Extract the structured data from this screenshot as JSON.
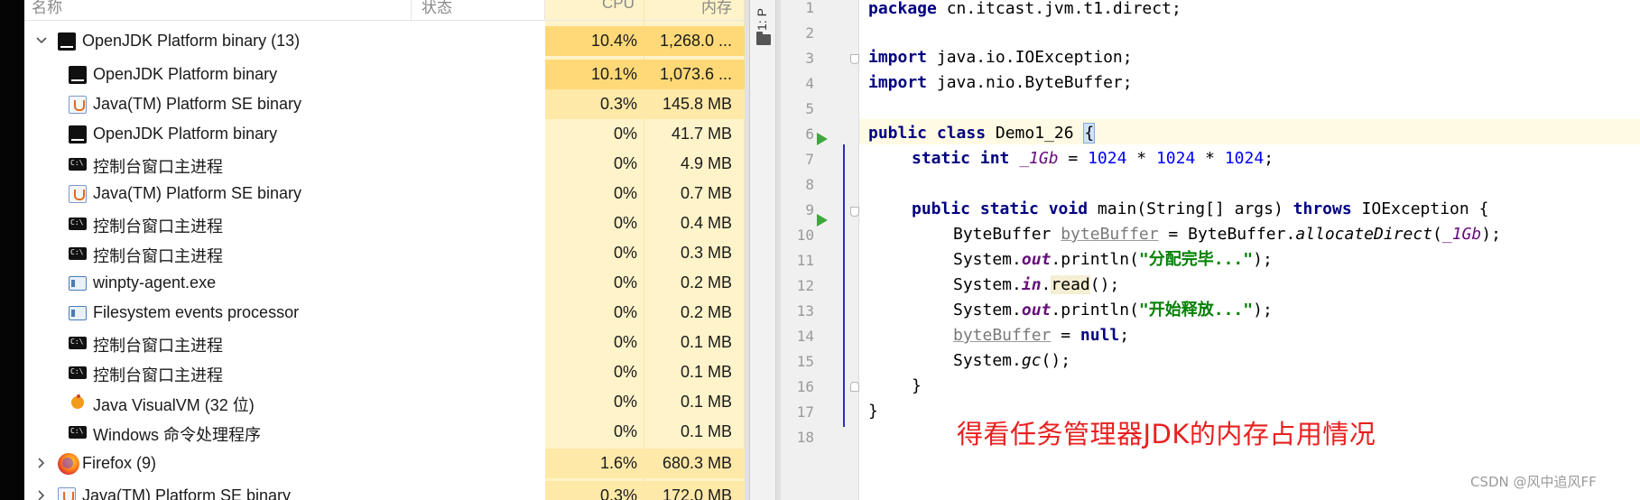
{
  "task_manager": {
    "columns": {
      "name": "名称",
      "status": "状态",
      "cpu": "CPU",
      "memory": "内存"
    },
    "rows": [
      {
        "name": "OpenJDK Platform binary (13)",
        "cpu": "10.4%",
        "mem": "1,268.0 ...",
        "icon": "jetbrains-icon",
        "group": true,
        "expanded": true
      },
      {
        "name": "OpenJDK Platform binary",
        "cpu": "10.1%",
        "mem": "1,073.6 ...",
        "icon": "jetbrains-icon"
      },
      {
        "name": "Java(TM) Platform SE binary",
        "cpu": "0.3%",
        "mem": "145.8 MB",
        "icon": "java-icon"
      },
      {
        "name": "OpenJDK Platform binary",
        "cpu": "0%",
        "mem": "41.7 MB",
        "icon": "jetbrains-icon"
      },
      {
        "name": "控制台窗口主进程",
        "cpu": "0%",
        "mem": "4.9 MB",
        "icon": "console-icon"
      },
      {
        "name": "Java(TM) Platform SE binary",
        "cpu": "0%",
        "mem": "0.7 MB",
        "icon": "java-icon"
      },
      {
        "name": "控制台窗口主进程",
        "cpu": "0%",
        "mem": "0.4 MB",
        "icon": "console-icon"
      },
      {
        "name": "控制台窗口主进程",
        "cpu": "0%",
        "mem": "0.3 MB",
        "icon": "console-icon"
      },
      {
        "name": "winpty-agent.exe",
        "cpu": "0%",
        "mem": "0.2 MB",
        "icon": "window-icon"
      },
      {
        "name": "Filesystem events processor",
        "cpu": "0%",
        "mem": "0.2 MB",
        "icon": "window-icon"
      },
      {
        "name": "控制台窗口主进程",
        "cpu": "0%",
        "mem": "0.1 MB",
        "icon": "console-icon"
      },
      {
        "name": "控制台窗口主进程",
        "cpu": "0%",
        "mem": "0.1 MB",
        "icon": "console-icon"
      },
      {
        "name": "Java VisualVM (32 位)",
        "cpu": "0%",
        "mem": "0.1 MB",
        "icon": "visualvm-icon"
      },
      {
        "name": "Windows 命令处理程序",
        "cpu": "0%",
        "mem": "0.1 MB",
        "icon": "console-icon"
      },
      {
        "name": "Firefox (9)",
        "cpu": "1.6%",
        "mem": "680.3 MB",
        "icon": "firefox-icon",
        "group": true,
        "expanded": false
      },
      {
        "name": "Java(TM) Platform SE binary",
        "cpu": "0.3%",
        "mem": "172.0 MB",
        "icon": "java-icon",
        "group": true,
        "expanded": false
      }
    ],
    "highlight_colors": {
      "light": "#fff3c9",
      "medium": "#ffe9a8",
      "strong": "#ffd978"
    }
  },
  "ide": {
    "project_tab": "1: P",
    "lines": [
      {
        "n": "1"
      },
      {
        "n": "2"
      },
      {
        "n": "3"
      },
      {
        "n": "4"
      },
      {
        "n": "5"
      },
      {
        "n": "6"
      },
      {
        "n": "7"
      },
      {
        "n": "8"
      },
      {
        "n": "9"
      },
      {
        "n": "10"
      },
      {
        "n": "11"
      },
      {
        "n": "12"
      },
      {
        "n": "13"
      },
      {
        "n": "14"
      },
      {
        "n": "15"
      },
      {
        "n": "16"
      },
      {
        "n": "17"
      },
      {
        "n": "18"
      }
    ],
    "code": {
      "l1_kw": "package",
      "l1_rest": " cn.itcast.jvm.t1.direct;",
      "l3_kw": "import",
      "l3_rest": " java.io.IOException;",
      "l4_kw": "import",
      "l4_rest": " java.nio.ByteBuffer;",
      "l6_kw": "public class",
      "l6_rest": " Demo1_26 ",
      "l6_brace": "{",
      "l7_kw": "static int",
      "l7_sp": " ",
      "l7_field": "_1Gb",
      "l7_eq": " = ",
      "l7_n1": "1024",
      "l7_op1": " * ",
      "l7_n2": "1024",
      "l7_op2": " * ",
      "l7_n3": "1024",
      "l7_end": ";",
      "l9_kw": "public static void",
      "l9_mid": " main(String[] args) ",
      "l9_kw2": "throws",
      "l9_rest": " IOException {",
      "l10_a": "ByteBuffer ",
      "l10_var": "byteBuffer",
      "l10_b": " = ByteBuffer.",
      "l10_m": "allocateDirect",
      "l10_c": "(",
      "l10_field": "_1Gb",
      "l10_d": ");",
      "l11_a": "System.",
      "l11_f": "out",
      "l11_b": ".println(",
      "l11_s": "\"分配完毕...\"",
      "l11_c": ");",
      "l12_a": "System.",
      "l12_f": "in",
      "l12_b": ".",
      "l12_rd": "read",
      "l12_c": "();",
      "l13_a": "System.",
      "l13_f": "out",
      "l13_b": ".println(",
      "l13_s": "\"开始释放...\"",
      "l13_c": ");",
      "l14_var": "byteBuffer",
      "l14_eq": " = ",
      "l14_kw": "null",
      "l14_end": ";",
      "l15_a": "System.",
      "l15_m": "gc",
      "l15_b": "();",
      "l16": "}",
      "l17": "}"
    },
    "colors": {
      "keyword": "#000080",
      "static_field": "#660e7a",
      "string": "#008000",
      "number": "#0000ff",
      "run": "#3ea83e"
    }
  },
  "annotation": "得看任务管理器JDK的内存占用情况",
  "watermark": "CSDN @风中追风FF"
}
